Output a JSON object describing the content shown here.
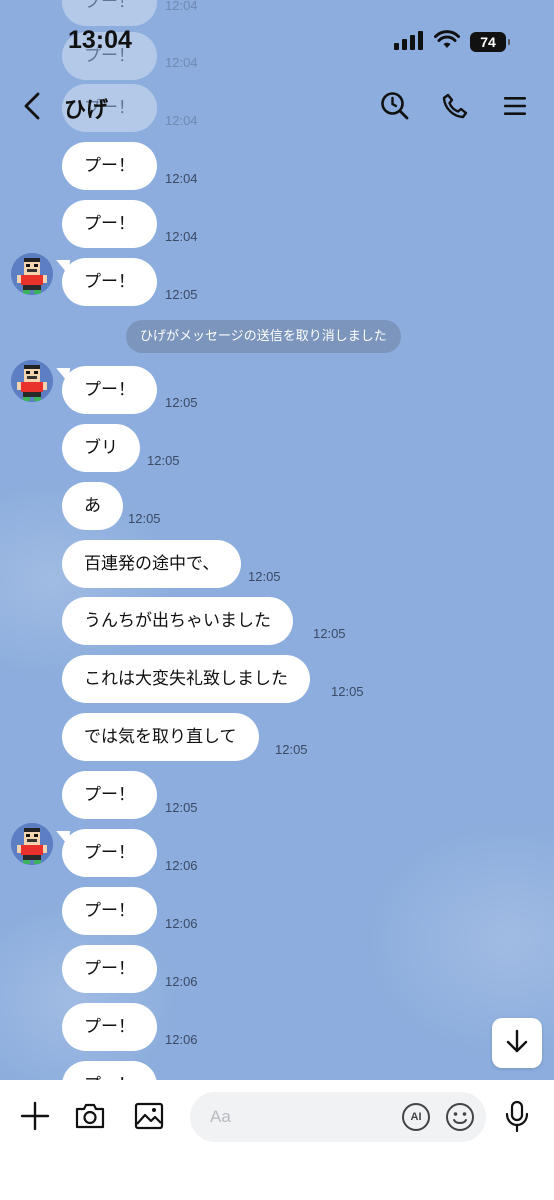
{
  "status_bar": {
    "time": "13:04",
    "battery": "74"
  },
  "nav": {
    "title": "ひげ"
  },
  "messages": [
    {
      "text": "プー！",
      "time": "12:04",
      "faded": true
    },
    {
      "text": "プー！",
      "time": "12:04",
      "faded": true
    },
    {
      "text": "プー！",
      "time": "12:04",
      "faded": true
    },
    {
      "text": "プー！",
      "time": "12:04"
    },
    {
      "text": "プー！",
      "time": "12:04"
    },
    {
      "text": "プー！",
      "time": "12:05",
      "avatar": true
    },
    {
      "text": "プー！",
      "time": "12:05",
      "avatar": true
    },
    {
      "text": "ブリ",
      "time": "12:05"
    },
    {
      "text": "あ",
      "time": "12:05"
    },
    {
      "text": "百連発の途中で、",
      "time": "12:05"
    },
    {
      "text": "うんちが出ちゃいました",
      "time": "12:05"
    },
    {
      "text": "これは大変失礼致しました",
      "time": "12:05"
    },
    {
      "text": "では気を取り直して",
      "time": "12:05"
    },
    {
      "text": "プー！",
      "time": "12:05"
    },
    {
      "text": "プー！",
      "time": "12:06",
      "avatar": true
    },
    {
      "text": "プー！",
      "time": "12:06"
    },
    {
      "text": "プー！",
      "time": "12:06"
    },
    {
      "text": "プー！",
      "time": "12:06"
    },
    {
      "text": "プー！",
      "time": ""
    }
  ],
  "system_message": "ひげがメッセージの送信を取り消しました",
  "input": {
    "placeholder": "Aa",
    "ai_label": "AI"
  },
  "icons": {
    "back": "chevron-left-icon",
    "search": "search-icon",
    "call": "phone-icon",
    "menu": "hamburger-menu-icon",
    "scroll_down": "arrow-down-icon",
    "plus": "plus-icon",
    "camera": "camera-icon",
    "image": "image-icon",
    "emoji": "emoji-icon",
    "mic": "microphone-icon"
  },
  "colors": {
    "background": "#8caddd",
    "bubble": "#ffffff",
    "timestamp": "#3b4a66"
  }
}
